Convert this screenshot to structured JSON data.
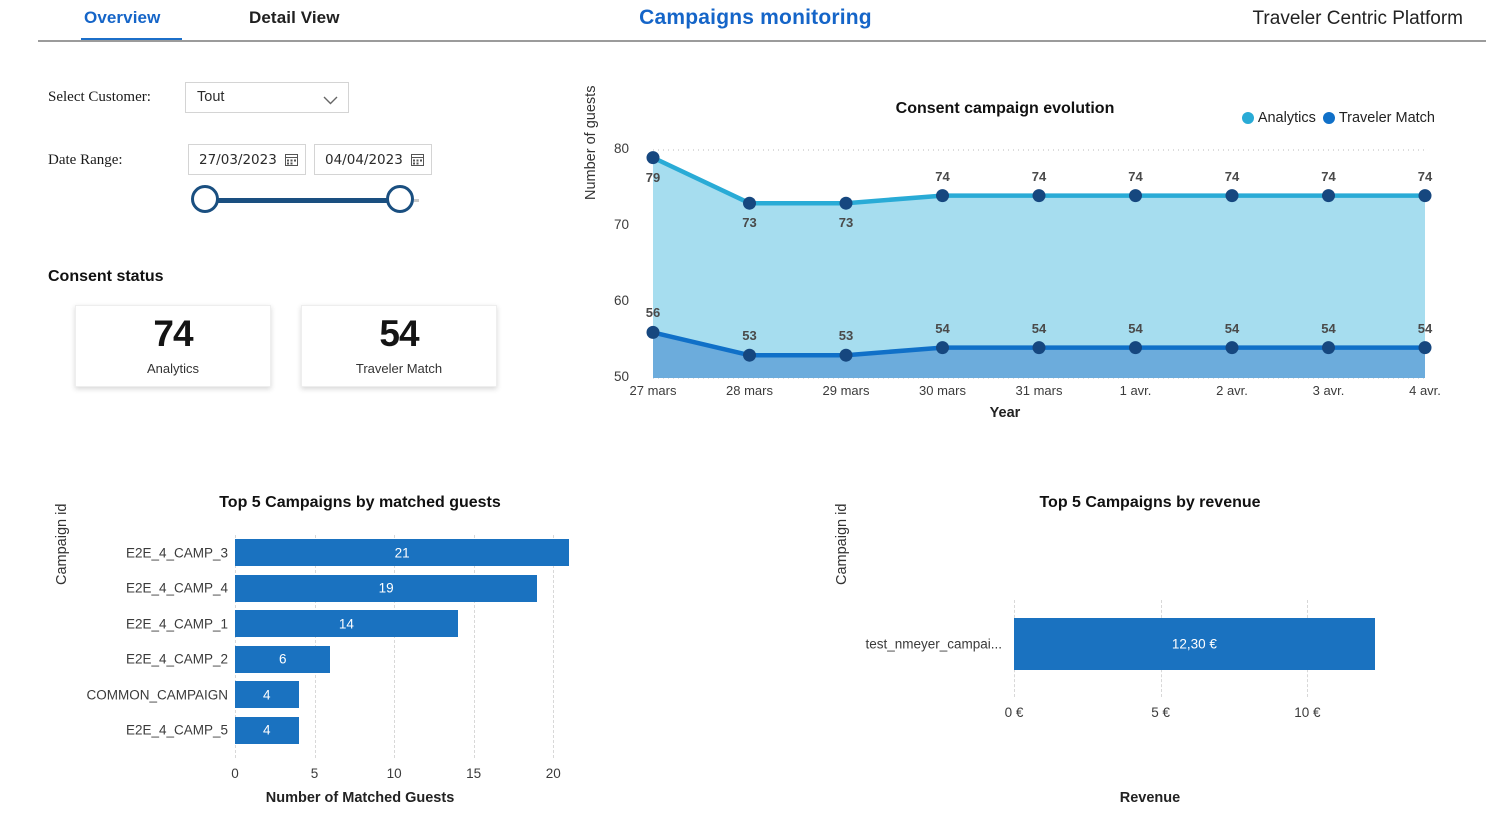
{
  "header": {
    "tabs": [
      {
        "label": "Overview",
        "active": true
      },
      {
        "label": "Detail View",
        "active": false
      }
    ],
    "app_title": "Campaigns monitoring",
    "platform_name": "Traveler Centric Platform",
    "accent_color": "#1565c8"
  },
  "filters": {
    "customer_label": "Select Customer:",
    "customer_value": "Tout",
    "customer_icon": "chevron-down-icon",
    "date_label": "Date Range:",
    "date_from": "27/03/2023",
    "date_to": "04/04/2023",
    "calendar_icon": "calendar-icon",
    "slider_icon": "range-slider"
  },
  "consent_status": {
    "heading": "Consent status",
    "cards": [
      {
        "value": "74",
        "label": "Analytics"
      },
      {
        "value": "54",
        "label": "Traveler Match"
      }
    ]
  },
  "chart_data": [
    {
      "type": "area",
      "id": "consent-campaign-evolution",
      "title": "Consent campaign evolution",
      "xlabel": "Year",
      "ylabel": "Number of guests",
      "ylim": [
        50,
        80
      ],
      "yticks": [
        50,
        60,
        70,
        80
      ],
      "grid": true,
      "legend_position": "top-right",
      "categories": [
        "27 mars",
        "28 mars",
        "29 mars",
        "30 mars",
        "31 mars",
        "1 avr.",
        "2 avr.",
        "3 avr.",
        "4 avr."
      ],
      "series": [
        {
          "name": "Analytics",
          "color": "#29abd6",
          "fill": "#a6ddef",
          "values": [
            79,
            73,
            73,
            74,
            74,
            74,
            74,
            74,
            74
          ]
        },
        {
          "name": "Traveler Match",
          "color": "#1070c8",
          "fill": "#6cacdc",
          "values": [
            56,
            53,
            53,
            54,
            54,
            54,
            54,
            54,
            54
          ]
        }
      ],
      "marker_color": "#16477f"
    },
    {
      "type": "bar",
      "orientation": "horizontal",
      "id": "top-5-campaigns-by-matched-guests",
      "title": "Top 5 Campaigns by matched guests",
      "xlabel": "Number of Matched Guests",
      "ylabel": "Campaign id",
      "xlim": [
        0,
        23
      ],
      "xticks": [
        "0",
        "5",
        "10",
        "15",
        "20"
      ],
      "xtick_values": [
        0,
        5,
        10,
        15,
        20
      ],
      "grid": true,
      "bar_color": "#1a72c0",
      "categories": [
        "E2E_4_CAMP_3",
        "E2E_4_CAMP_4",
        "E2E_4_CAMP_1",
        "E2E_4_CAMP_2",
        "COMMON_CAMPAIGN",
        "E2E_4_CAMP_5"
      ],
      "values": [
        21,
        19,
        14,
        6,
        4,
        4
      ],
      "value_labels": [
        "21",
        "19",
        "14",
        "6",
        "4",
        "4"
      ]
    },
    {
      "type": "bar",
      "orientation": "horizontal",
      "id": "top-5-campaigns-by-revenue",
      "title": "Top 5 Campaigns by revenue",
      "xlabel": "Revenue",
      "ylabel": "Campaign id",
      "xlim": [
        0,
        13.5
      ],
      "xticks": [
        "0 €",
        "5 €",
        "10 €"
      ],
      "xtick_values": [
        0,
        5,
        10
      ],
      "grid": true,
      "bar_color": "#1a72c0",
      "categories": [
        "test_nmeyer_campai..."
      ],
      "values": [
        12.3
      ],
      "value_labels": [
        "12,30 €"
      ]
    }
  ]
}
